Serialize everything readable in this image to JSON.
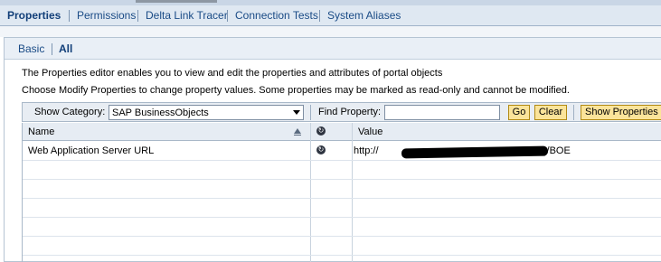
{
  "main_tabs": [
    {
      "label": "Properties",
      "active": true
    },
    {
      "label": "Permissions",
      "active": false
    },
    {
      "label": "Delta Link Tracer",
      "active": false
    },
    {
      "label": "Connection Tests",
      "active": false
    },
    {
      "label": "System Aliases",
      "active": false
    }
  ],
  "sub_tabs": [
    {
      "label": "Basic",
      "active": false
    },
    {
      "label": "All",
      "active": true
    }
  ],
  "description": {
    "line1": "The Properties editor enables you to view and edit the properties and attributes of portal objects",
    "line2": "Choose Modify Properties to change property values. Some properties may be marked as read-only and cannot be modified."
  },
  "toolbar": {
    "show_category_label": "Show Category:",
    "category_value": "SAP BusinessObjects",
    "find_property_label": "Find Property:",
    "find_property_value": "",
    "go_label": "Go",
    "clear_label": "Clear",
    "show_properties_label": "Show Properties"
  },
  "table": {
    "columns": [
      "Name",
      "",
      "Value"
    ],
    "rows": [
      {
        "name": "Web Application Server URL",
        "value_prefix": "http://",
        "value_suffix": ":8080/BOE"
      }
    ]
  },
  "icons": {
    "sort": "sort-ascending-icon",
    "inherit": "inheritance-icon"
  },
  "colors": {
    "tab_bar": "#dfe8f2",
    "link": "#1a4b86",
    "button": "#fbe49a",
    "header": "#e6ecf3"
  }
}
